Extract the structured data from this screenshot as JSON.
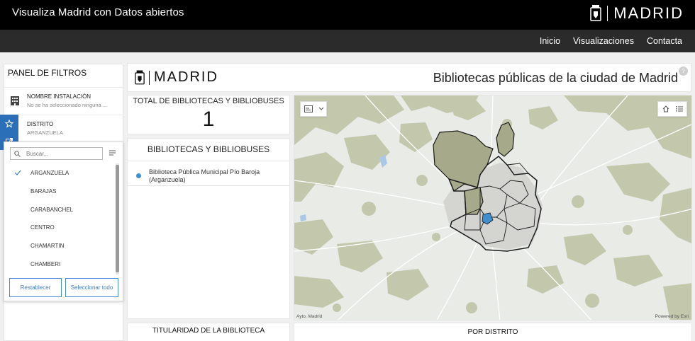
{
  "topbar": {
    "title": "Visualiza Madrid con Datos abiertos",
    "brand": "MADRID"
  },
  "nav": {
    "links": [
      "Inicio",
      "Visualizaciones",
      "Contacta"
    ]
  },
  "filters": {
    "panel_title": "PANEL DE FILTROS",
    "items": [
      {
        "label": "NOMBRE INSTALACIÓN",
        "value": "No se ha seleccionado ninguna ..."
      },
      {
        "label": "DISTRITO",
        "value": "ARGANZUELA"
      }
    ],
    "search_placeholder": "Buscar...",
    "options": [
      {
        "label": "ARGANZUELA",
        "checked": true
      },
      {
        "label": "BARAJAS",
        "checked": false
      },
      {
        "label": "CARABANCHEL",
        "checked": false
      },
      {
        "label": "CENTRO",
        "checked": false
      },
      {
        "label": "CHAMARTIN",
        "checked": false
      },
      {
        "label": "CHAMBERI",
        "checked": false
      }
    ],
    "reset_label": "Restablecer",
    "select_all_label": "Seleccionar todo"
  },
  "dashboard": {
    "logo": "MADRID",
    "title": "Bibliotecas públicas de la ciudad de Madrid",
    "help": "?"
  },
  "kpi": {
    "label": "TOTAL DE BIBLIOTECAS Y BIBLIOBUSES",
    "value": "1"
  },
  "list": {
    "title": "BIBLIOTECAS Y BIBLIOBUSES",
    "items": [
      "Biblioteca Pública Municipal Pío Baroja (Arganzuela)"
    ]
  },
  "map": {
    "attribution_left": "Ayto. Madrid",
    "attribution_right": "Powered by Esri",
    "accent": "#3e8ed0"
  },
  "bottom": {
    "card1_title": "TITULARIDAD DE LA BIBLIOTECA",
    "card2_title": "POR DISTRITO"
  },
  "colors": {
    "topbar": "#000000",
    "navbar": "#2b2b2b",
    "accent_blue": "#2b6fb8",
    "map_green": "#c3c8ad"
  }
}
